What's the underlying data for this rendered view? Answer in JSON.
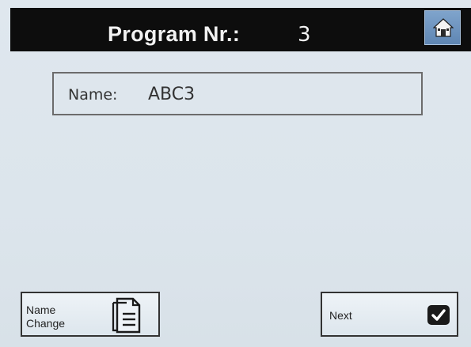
{
  "header": {
    "title_label": "Program Nr.:",
    "program_number": "3",
    "home_icon": "home-icon"
  },
  "main": {
    "name_label": "Name:",
    "name_value": "ABC3"
  },
  "footer": {
    "name_change_label": "Name\nChange",
    "name_change_icon": "document-icon",
    "next_label": "Next",
    "next_icon": "checkmark-icon"
  },
  "colors": {
    "titlebar": "#0d0d0d",
    "home_button": "#6a90bd",
    "screen_background": "#dce5ec"
  }
}
